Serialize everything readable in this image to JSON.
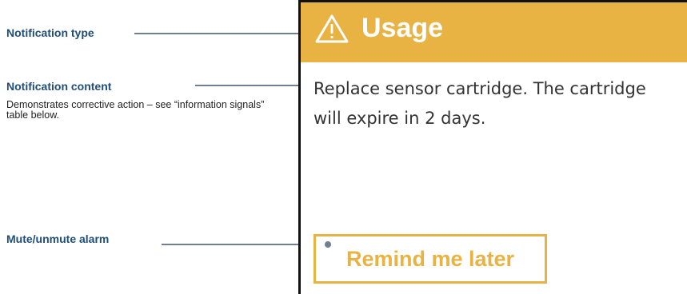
{
  "annotations": {
    "notification_type": {
      "label": "Notification type"
    },
    "notification_content": {
      "label": "Notification content",
      "description": "Demonstrates corrective action – see “information signals” table below."
    },
    "mute_alarm": {
      "label": "Mute/unmute alarm"
    }
  },
  "screen": {
    "header": {
      "icon": "warning-triangle-icon",
      "title": "Usage"
    },
    "message": "Replace sensor cartridge. The cartridge will expire in 2 days.",
    "button_label": "Remind me later"
  },
  "colors": {
    "header_bg": "#e9b344",
    "label_text": "#1f4e79",
    "leader_line": "#6e7f94",
    "message_text": "#333333"
  }
}
